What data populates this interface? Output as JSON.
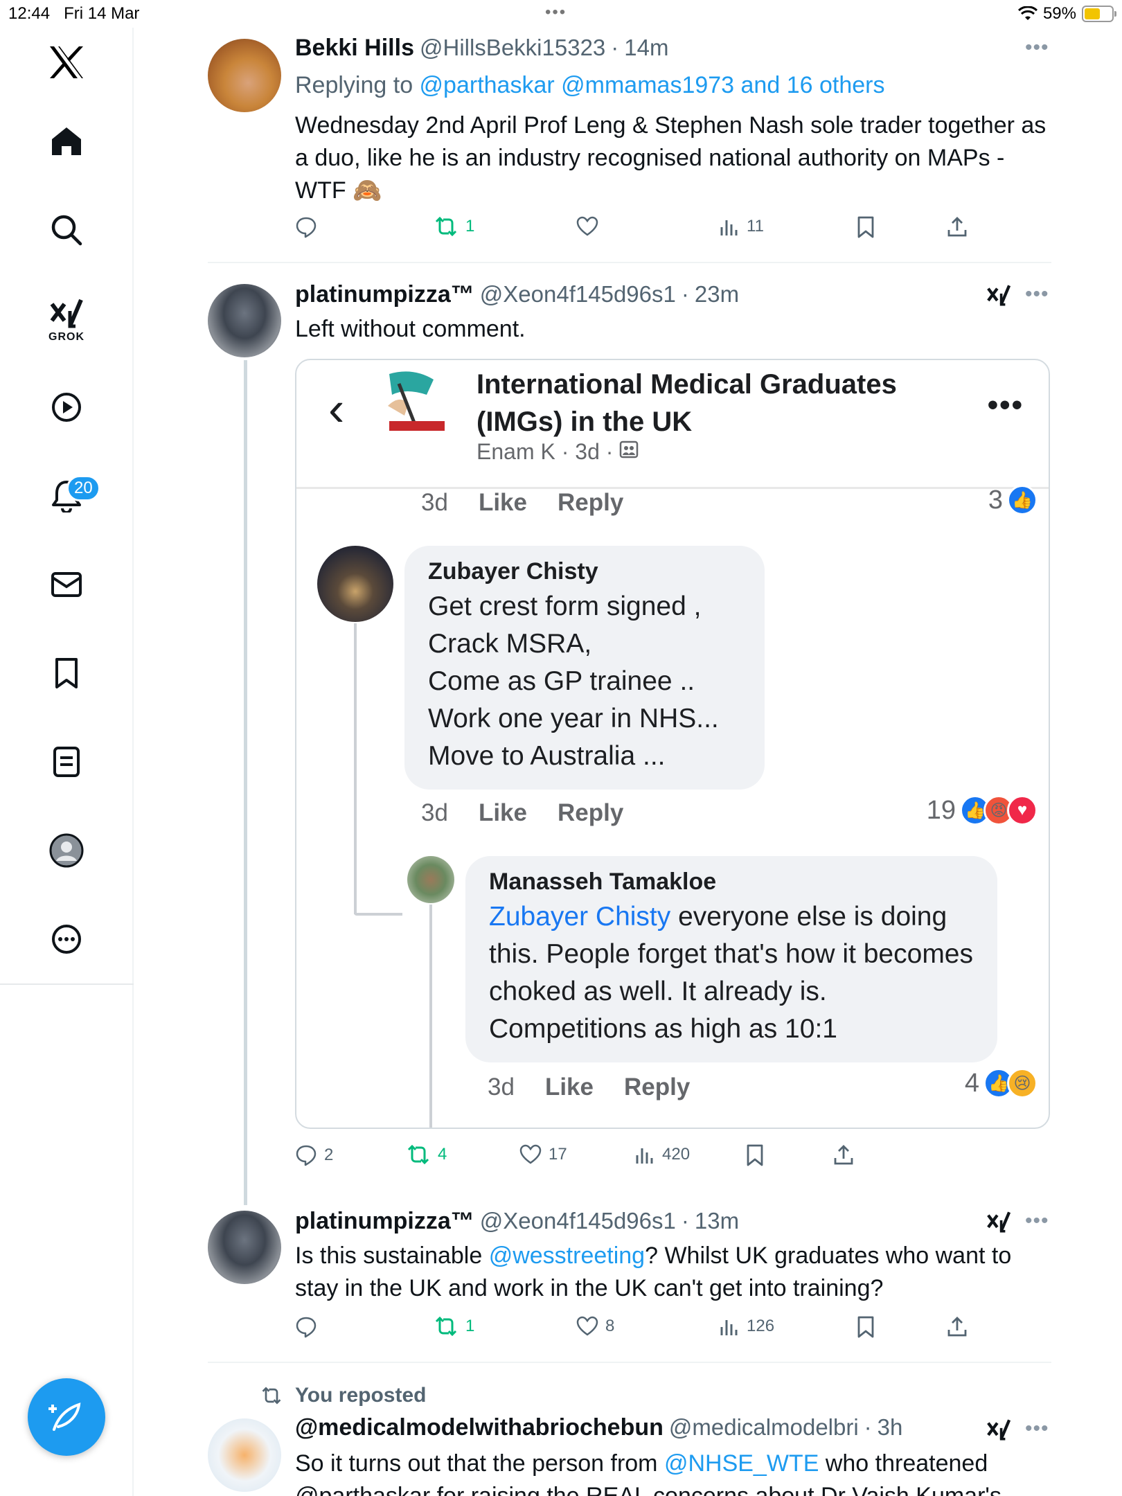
{
  "status_bar": {
    "time": "12:44",
    "date": "Fri 14 Mar",
    "battery_percent": "59%",
    "battery_level": 0.59
  },
  "sidebar": {
    "items": [
      {
        "name": "home",
        "icon": "home-icon"
      },
      {
        "name": "search",
        "icon": "search-icon"
      },
      {
        "name": "grok",
        "icon": "grok-icon",
        "label": "GROK"
      },
      {
        "name": "video",
        "icon": "play-icon"
      },
      {
        "name": "notifications",
        "icon": "bell-icon",
        "badge": "20"
      },
      {
        "name": "messages",
        "icon": "mail-icon"
      },
      {
        "name": "bookmarks",
        "icon": "bookmark-icon"
      },
      {
        "name": "lists",
        "icon": "list-icon"
      },
      {
        "name": "profile",
        "icon": "avatar-icon"
      },
      {
        "name": "more",
        "icon": "more-icon"
      }
    ],
    "compose_icon": "compose-icon"
  },
  "tweets": [
    {
      "name": "Bekki Hills",
      "handle": "@HillsBekki15323",
      "time": "14m",
      "replying_prefix": "Replying to ",
      "replying_to": "@parthaskar @mmamas1973 and 16 others",
      "text": "Wednesday 2nd April Prof Leng & Stephen Nash sole trader together as a duo, like he is an industry recognised national authority on MAPs - WTF 🙈",
      "replies": "",
      "reposts": "1",
      "likes": "",
      "views": "11"
    },
    {
      "name": "platinumpizza™",
      "handle": "@Xeon4f145d96s1",
      "time": "23m",
      "text": "Left without comment.",
      "replies": "2",
      "reposts": "4",
      "likes": "17",
      "views": "420",
      "embed": {
        "group_title": "International Medical Graduates (IMGs) in the UK",
        "group_sub": "Enam K · 3d ·",
        "top_meta": {
          "time": "3d",
          "like": "Like",
          "reply": "Reply",
          "count": "3"
        },
        "comments": [
          {
            "author": "Zubayer Chisty",
            "lines": [
              "Get crest form signed ,",
              "Crack MSRA,",
              "Come as GP trainee ..",
              "Work one year in NHS...",
              "Move to Australia ..."
            ],
            "time": "3d",
            "like": "Like",
            "reply": "Reply",
            "count": "19"
          },
          {
            "author": "Manasseh Tamakloe",
            "mention": "Zubayer Chisty",
            "text": " everyone else is doing this. People forget that's how it becomes choked as well. It already is. Competitions as high as 10:1",
            "time": "3d",
            "like": "Like",
            "reply": "Reply",
            "count": "4"
          }
        ]
      }
    },
    {
      "name": "platinumpizza™",
      "handle": "@Xeon4f145d96s1",
      "time": "13m",
      "text_before": "Is this sustainable ",
      "mention": "@wesstreeting",
      "text_after": "? Whilst UK graduates who want to stay in the UK and work in the UK can't get into training?",
      "replies": "",
      "reposts": "1",
      "likes": "8",
      "views": "126"
    },
    {
      "repost_label": "You reposted",
      "name": "@medicalmodelwithabriochebun",
      "handle": "@medicalmodelbri",
      "time": "3h",
      "text_before": "So it turns out that the person from ",
      "mention": "@NHSE_WTE",
      "text_after": "  who threatened",
      "second_line": "@parthaskar for raising the REAL concerns about Dr Vaish Kumar's"
    }
  ]
}
